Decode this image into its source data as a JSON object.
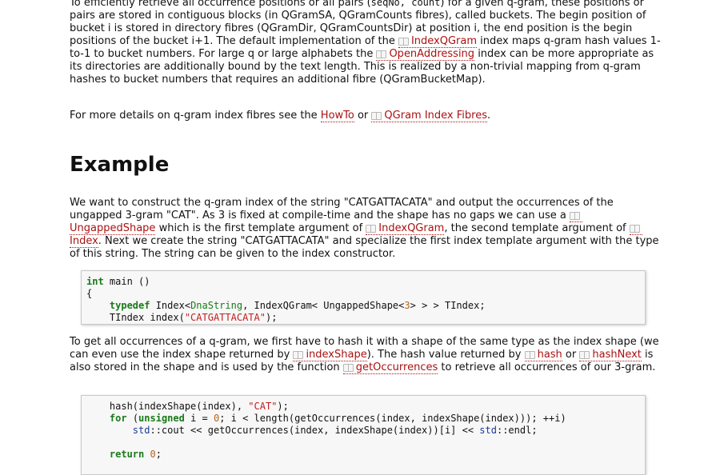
{
  "intro": {
    "t1": "To efficiently retrieve all occurrence positions or all pairs (",
    "code1": "seqNo, count",
    "t2": ") for a given q-gram, these positions or pairs are stored in contiguous blocks (in QGramSA, QGramCounts fibres), called buckets. The begin position of bucket i is stored in directory fibres (QGramDir, QGramCountsDir) at position i, the end position is the begin positions of the bucket i+1. The default implementation of the ",
    "link_indexqgram": "IndexQGram",
    "t3": " index maps q-gram hash values 1-to-1 to bucket numbers. For large q or large alphabets the ",
    "link_openaddressing": "OpenAddressing",
    "t4": " index can be more appropriate as its directories are additionally bound by the text length. This is realized by a non-trivial mapping from q-gram hashes to bucket numbers that requires an additional fibre (QGramBucketMap)."
  },
  "details": {
    "t1": "For more details on q-gram index fibres see the ",
    "link_howto": "HowTo",
    "t2": " or ",
    "link_fibres": "QGram Index Fibres",
    "t3": "."
  },
  "example_heading": "Example",
  "example": {
    "t1": "We want to construct the q-gram index of the string \"CATGATTACATA\" and output the occurrences of the ungapped 3-gram \"CAT\". As 3 is fixed at compile-time and the shape has no gaps we can use a ",
    "link_ungappedshape": "UngappedShape",
    "t2": " which is the first template argument of ",
    "link_indexqgram": "IndexQGram",
    "t3": ", the second template argument of ",
    "link_index": "Index",
    "t4": ". Next we create the string \"CATGATTACATA\" and specialize the first index template argument with the type of this string. The string can be given to the index constructor."
  },
  "code1": {
    "l1_kw": "int",
    "l1_rest": " main ()",
    "l2": "{",
    "l3_kw": "typedef",
    "l3_a": " Index<",
    "l3_t1": "DnaString",
    "l3_b": ", IndexQGram< UngappedShape<",
    "l3_n": "3",
    "l3_c": "> > > TIndex;",
    "l4_a": "TIndex index(",
    "l4_s": "\"CATGATTACATA\"",
    "l4_b": ");"
  },
  "hash_para": {
    "t1": "To get all occurrences of a q-gram, we first have to hash it with a shape of the same type as the index shape (we can even use the index shape returned by ",
    "link_indexshape": "indexShape",
    "t2": "). The hash value returned by ",
    "link_hash": "hash",
    "t3": " or ",
    "link_hashnext": "hashNext",
    "t4": " is also stored in the shape and is used by the function ",
    "link_getoccurrences": "getOccurrences",
    "t5": " to retrieve all occurrences of our 3-gram."
  },
  "code2": {
    "l1_a": "hash(indexShape(index), ",
    "l1_s": "\"CAT\"",
    "l1_b": ");",
    "l2_kw": "for",
    "l2_a": " (",
    "l2_kw2": "unsigned",
    "l2_b": " i = ",
    "l2_n": "0",
    "l2_c": "; i < length(getOccurrences(index, indexShape(index))); ++i)",
    "l3_a": "std",
    "l3_b": "::cout << getOccurrences(index, indexShape(index))[i] << ",
    "l3_c": "std",
    "l3_d": "::endl;",
    "l5_kw": "return",
    "l5_sp": " ",
    "l5_n": "0",
    "l5_end": ";"
  }
}
